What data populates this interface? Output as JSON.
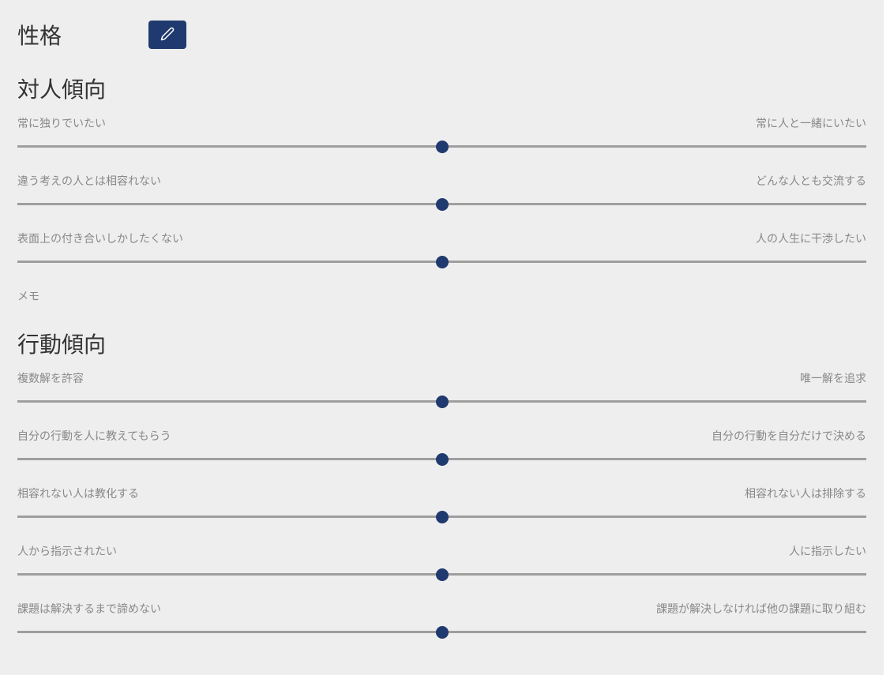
{
  "page_title": "性格",
  "edit_icon": "pencil-icon",
  "sections": [
    {
      "heading": "対人傾向",
      "sliders": [
        {
          "left": "常に独りでいたい",
          "right": "常に人と一緒にいたい",
          "value": 50
        },
        {
          "left": "違う考えの人とは相容れない",
          "right": "どんな人とも交流する",
          "value": 50
        },
        {
          "left": "表面上の付き合いしかしたくない",
          "right": "人の人生に干渉したい",
          "value": 50
        }
      ],
      "memo_label": "メモ"
    },
    {
      "heading": "行動傾向",
      "sliders": [
        {
          "left": "複数解を許容",
          "right": "唯一解を追求",
          "value": 50
        },
        {
          "left": "自分の行動を人に教えてもらう",
          "right": "自分の行動を自分だけで決める",
          "value": 50
        },
        {
          "left": "相容れない人は教化する",
          "right": "相容れない人は排除する",
          "value": 50
        },
        {
          "left": "人から指示されたい",
          "right": "人に指示したい",
          "value": 50
        },
        {
          "left": "課題は解決するまで諦めない",
          "right": "課題が解決しなければ他の課題に取り組む",
          "value": 50
        }
      ]
    }
  ]
}
